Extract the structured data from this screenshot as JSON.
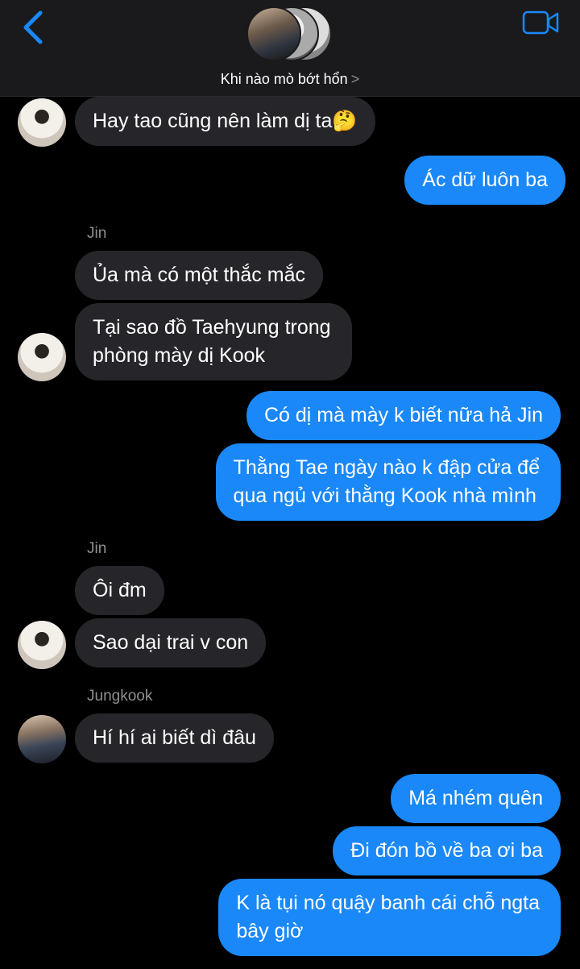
{
  "header": {
    "group_name": "Khi nào mò bớt hổn",
    "chevron": ">"
  },
  "messages": [
    {
      "from": "Jin",
      "side": "in",
      "text": "Hay tao cũng nên làm dị ta🤔"
    },
    {
      "side": "out",
      "text": "Ác dữ luôn ba"
    },
    {
      "sender_label": "Jin"
    },
    {
      "from": "Jin",
      "side": "in",
      "text": "Ủa mà có một thắc mắc"
    },
    {
      "from": "Jin",
      "side": "in",
      "line1": "Tại sao đồ Taehyung trong",
      "line2": "phòng mày dị Kook"
    },
    {
      "side": "out",
      "text": "Có dị mà mày k biết nữa hả Jin"
    },
    {
      "side": "out",
      "line1": "Thằng Tae ngày nào k đập cửa để",
      "line2": "qua ngủ với thằng Kook nhà mình"
    },
    {
      "sender_label": "Jin"
    },
    {
      "from": "Jin",
      "side": "in",
      "text": "Ôi đm"
    },
    {
      "from": "Jin",
      "side": "in",
      "text": "Sao dại trai v con"
    },
    {
      "sender_label": "Jungkook"
    },
    {
      "from": "Jungkook",
      "side": "in",
      "text": "Hí hí ai biết dì đâu"
    },
    {
      "side": "out",
      "text": "Má nhém quên"
    },
    {
      "side": "out",
      "text": "Đi đón bồ về ba ơi ba"
    },
    {
      "side": "out",
      "line1": "K là tụi nó quậy banh cái chỗ ngta",
      "line2": "bây giờ"
    }
  ],
  "colors": {
    "incoming_bubble": "#26252a",
    "outgoing_bubble": "#1a88f8",
    "accent": "#1a88f8",
    "background": "#000000"
  },
  "icons": [
    "back-chevron-icon",
    "video-call-icon"
  ]
}
